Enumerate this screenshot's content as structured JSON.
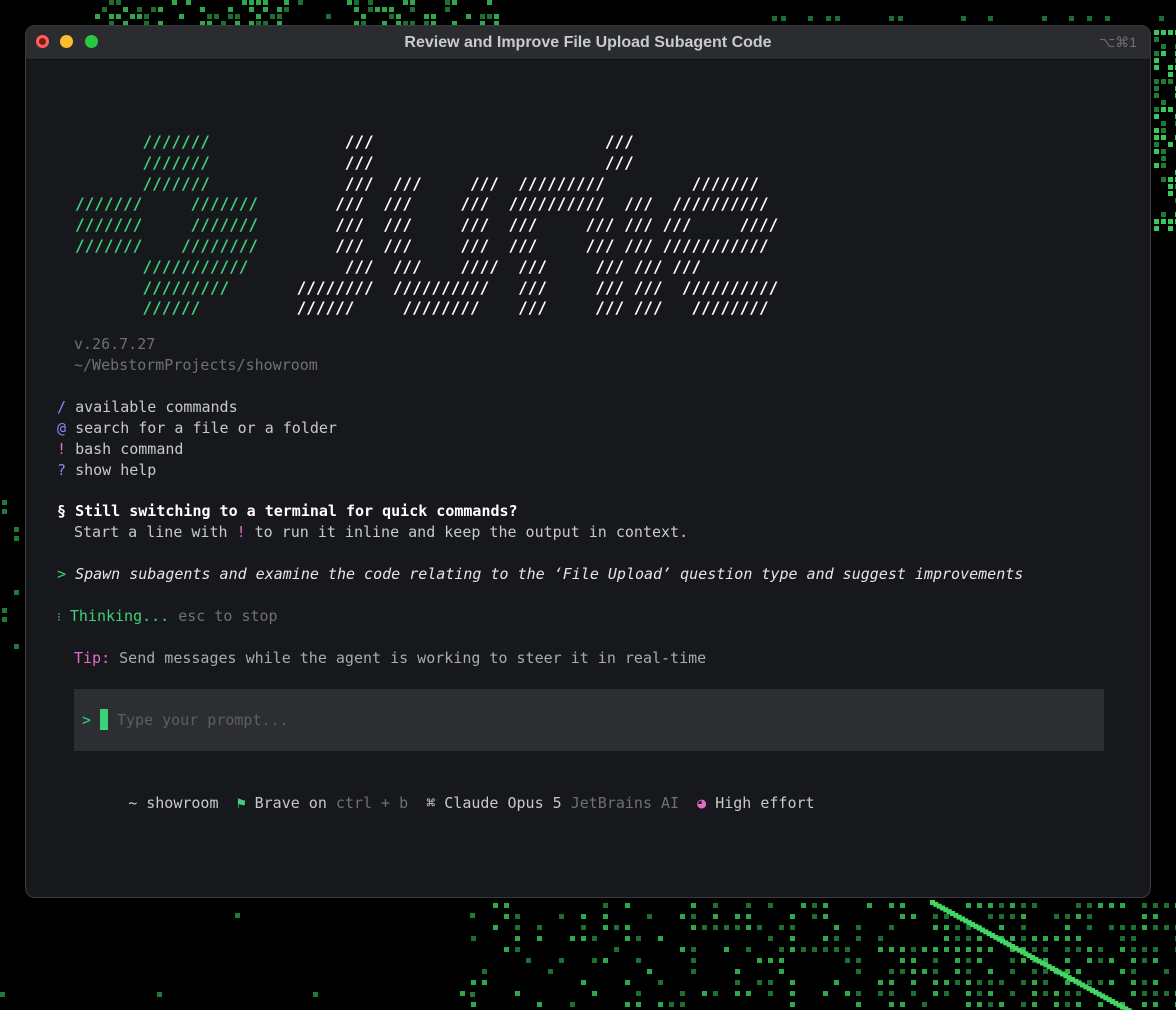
{
  "window": {
    "title": "Review and Improve File Upload Subagent Code",
    "shortcut": "⌥⌘1"
  },
  "logo": {
    "rows": [
      [
        [
          "",
          "       "
        ],
        [
          "g",
          "///////"
        ],
        [
          "w",
          "              ///                        ///"
        ]
      ],
      [
        [
          "",
          "       "
        ],
        [
          "g",
          "///////"
        ],
        [
          "w",
          "              ///                        ///"
        ]
      ],
      [
        [
          "",
          "       "
        ],
        [
          "g",
          "///////"
        ],
        [
          "w",
          "              ///  ///     ///  /////////         ///////"
        ]
      ],
      [
        [
          "g",
          "///////     ///////"
        ],
        [
          "w",
          "        ///  ///     ///  //////////  ///  //////////"
        ]
      ],
      [
        [
          "g",
          "///////     ///////"
        ],
        [
          "w",
          "        ///  ///     ///  ///     /// /// ///     ////"
        ]
      ],
      [
        [
          "g",
          "///////    ////////"
        ],
        [
          "w",
          "        ///  ///     ///  ///     /// /// ///////////"
        ]
      ],
      [
        [
          "",
          "       "
        ],
        [
          "g",
          "///////////"
        ],
        [
          "w",
          "          ///  ///    ////  ///     /// /// ///"
        ]
      ],
      [
        [
          "",
          "       "
        ],
        [
          "g",
          "/////////"
        ],
        [
          "w",
          "       ////////  //////////   ///     /// ///  //////////"
        ]
      ],
      [
        [
          "",
          "       "
        ],
        [
          "g",
          "//////"
        ],
        [
          "w",
          "          //////     ////////    ///     /// ///   ////////"
        ]
      ]
    ]
  },
  "info": {
    "version": "v.26.7.27",
    "path": "~/WebstormProjects/showroom"
  },
  "commands": [
    {
      "symbol": "/",
      "label": "available commands",
      "color": "#8f86f5"
    },
    {
      "symbol": "@",
      "label": "search for a file or a folder",
      "color": "#8f86f5"
    },
    {
      "symbol": "!",
      "label": "bash command",
      "color": "#e06bc8"
    },
    {
      "symbol": "?",
      "label": "show help",
      "color": "#8f86f5"
    }
  ],
  "hint": {
    "symbol": "§",
    "heading": "Still switching to a terminal for quick commands?",
    "text_before": "Start a line with ",
    "bang": "!",
    "text_after": " to run it inline and keep the output in context."
  },
  "user_message": {
    "prompt": ">",
    "text": "Spawn subagents and examine the code relating to the ‘File Upload’ question type and suggest improvements"
  },
  "thinking": {
    "spinner": "⁝",
    "label": "Thinking...",
    "hint": "esc to stop"
  },
  "tip": {
    "label": "Tip:",
    "text": "Send messages while the agent is working to steer it in real-time"
  },
  "input": {
    "prompt": ">",
    "placeholder": "Type your prompt..."
  },
  "status": {
    "dir_prefix": "~",
    "dir": "showroom",
    "flag_icon": "⚑",
    "brave_label": "Brave on",
    "brave_shortcut": "ctrl + b",
    "model_icon": "⌘",
    "model": "Claude Opus 5",
    "provider": "JetBrains AI",
    "effort_icon": "◕",
    "effort": "High effort"
  },
  "colors": {
    "accent_green": "#3dd27a",
    "purple": "#8f86f5",
    "pink": "#e06bc8",
    "window_bg": "#17181b"
  }
}
